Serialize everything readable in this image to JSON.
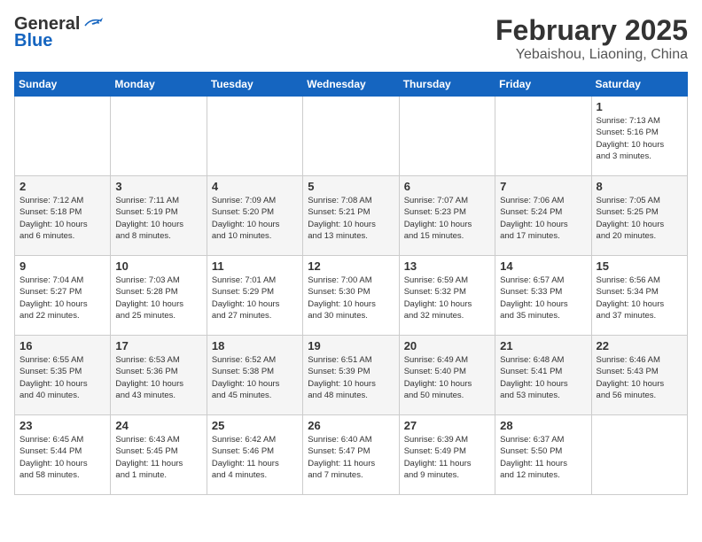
{
  "header": {
    "logo_general": "General",
    "logo_blue": "Blue",
    "title": "February 2025",
    "subtitle": "Yebaishou, Liaoning, China"
  },
  "weekdays": [
    "Sunday",
    "Monday",
    "Tuesday",
    "Wednesday",
    "Thursday",
    "Friday",
    "Saturday"
  ],
  "weeks": [
    [
      {
        "day": "",
        "info": ""
      },
      {
        "day": "",
        "info": ""
      },
      {
        "day": "",
        "info": ""
      },
      {
        "day": "",
        "info": ""
      },
      {
        "day": "",
        "info": ""
      },
      {
        "day": "",
        "info": ""
      },
      {
        "day": "1",
        "info": "Sunrise: 7:13 AM\nSunset: 5:16 PM\nDaylight: 10 hours\nand 3 minutes."
      }
    ],
    [
      {
        "day": "2",
        "info": "Sunrise: 7:12 AM\nSunset: 5:18 PM\nDaylight: 10 hours\nand 6 minutes."
      },
      {
        "day": "3",
        "info": "Sunrise: 7:11 AM\nSunset: 5:19 PM\nDaylight: 10 hours\nand 8 minutes."
      },
      {
        "day": "4",
        "info": "Sunrise: 7:09 AM\nSunset: 5:20 PM\nDaylight: 10 hours\nand 10 minutes."
      },
      {
        "day": "5",
        "info": "Sunrise: 7:08 AM\nSunset: 5:21 PM\nDaylight: 10 hours\nand 13 minutes."
      },
      {
        "day": "6",
        "info": "Sunrise: 7:07 AM\nSunset: 5:23 PM\nDaylight: 10 hours\nand 15 minutes."
      },
      {
        "day": "7",
        "info": "Sunrise: 7:06 AM\nSunset: 5:24 PM\nDaylight: 10 hours\nand 17 minutes."
      },
      {
        "day": "8",
        "info": "Sunrise: 7:05 AM\nSunset: 5:25 PM\nDaylight: 10 hours\nand 20 minutes."
      }
    ],
    [
      {
        "day": "9",
        "info": "Sunrise: 7:04 AM\nSunset: 5:27 PM\nDaylight: 10 hours\nand 22 minutes."
      },
      {
        "day": "10",
        "info": "Sunrise: 7:03 AM\nSunset: 5:28 PM\nDaylight: 10 hours\nand 25 minutes."
      },
      {
        "day": "11",
        "info": "Sunrise: 7:01 AM\nSunset: 5:29 PM\nDaylight: 10 hours\nand 27 minutes."
      },
      {
        "day": "12",
        "info": "Sunrise: 7:00 AM\nSunset: 5:30 PM\nDaylight: 10 hours\nand 30 minutes."
      },
      {
        "day": "13",
        "info": "Sunrise: 6:59 AM\nSunset: 5:32 PM\nDaylight: 10 hours\nand 32 minutes."
      },
      {
        "day": "14",
        "info": "Sunrise: 6:57 AM\nSunset: 5:33 PM\nDaylight: 10 hours\nand 35 minutes."
      },
      {
        "day": "15",
        "info": "Sunrise: 6:56 AM\nSunset: 5:34 PM\nDaylight: 10 hours\nand 37 minutes."
      }
    ],
    [
      {
        "day": "16",
        "info": "Sunrise: 6:55 AM\nSunset: 5:35 PM\nDaylight: 10 hours\nand 40 minutes."
      },
      {
        "day": "17",
        "info": "Sunrise: 6:53 AM\nSunset: 5:36 PM\nDaylight: 10 hours\nand 43 minutes."
      },
      {
        "day": "18",
        "info": "Sunrise: 6:52 AM\nSunset: 5:38 PM\nDaylight: 10 hours\nand 45 minutes."
      },
      {
        "day": "19",
        "info": "Sunrise: 6:51 AM\nSunset: 5:39 PM\nDaylight: 10 hours\nand 48 minutes."
      },
      {
        "day": "20",
        "info": "Sunrise: 6:49 AM\nSunset: 5:40 PM\nDaylight: 10 hours\nand 50 minutes."
      },
      {
        "day": "21",
        "info": "Sunrise: 6:48 AM\nSunset: 5:41 PM\nDaylight: 10 hours\nand 53 minutes."
      },
      {
        "day": "22",
        "info": "Sunrise: 6:46 AM\nSunset: 5:43 PM\nDaylight: 10 hours\nand 56 minutes."
      }
    ],
    [
      {
        "day": "23",
        "info": "Sunrise: 6:45 AM\nSunset: 5:44 PM\nDaylight: 10 hours\nand 58 minutes."
      },
      {
        "day": "24",
        "info": "Sunrise: 6:43 AM\nSunset: 5:45 PM\nDaylight: 11 hours\nand 1 minute."
      },
      {
        "day": "25",
        "info": "Sunrise: 6:42 AM\nSunset: 5:46 PM\nDaylight: 11 hours\nand 4 minutes."
      },
      {
        "day": "26",
        "info": "Sunrise: 6:40 AM\nSunset: 5:47 PM\nDaylight: 11 hours\nand 7 minutes."
      },
      {
        "day": "27",
        "info": "Sunrise: 6:39 AM\nSunset: 5:49 PM\nDaylight: 11 hours\nand 9 minutes."
      },
      {
        "day": "28",
        "info": "Sunrise: 6:37 AM\nSunset: 5:50 PM\nDaylight: 11 hours\nand 12 minutes."
      },
      {
        "day": "",
        "info": ""
      }
    ]
  ]
}
